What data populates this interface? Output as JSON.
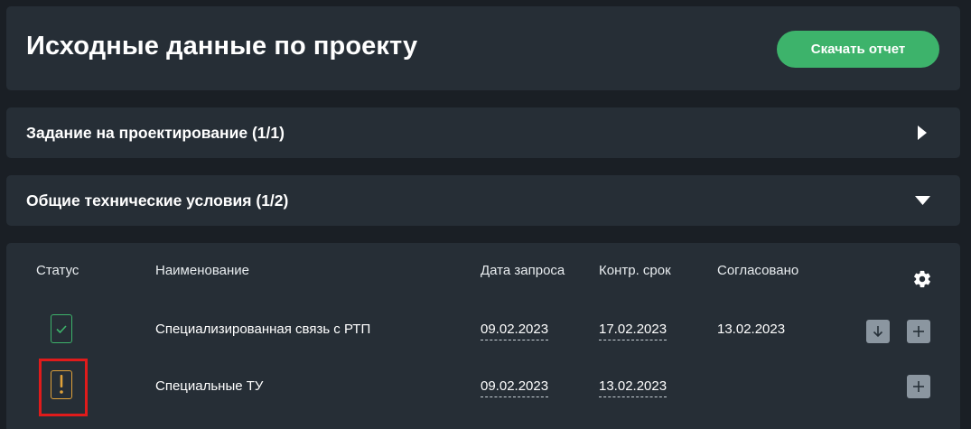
{
  "header": {
    "title": "Исходные данные по проекту",
    "download_label": "Скачать отчет"
  },
  "sections": [
    {
      "title": "Задание на проектирование (1/1)",
      "state": "collapsed"
    },
    {
      "title": "Общие технические условия (1/2)",
      "state": "expanded"
    }
  ],
  "table": {
    "columns": {
      "status": "Статус",
      "name": "Наименование",
      "request_date": "Дата запроса",
      "control_date": "Контр. срок",
      "approved": "Согласовано"
    },
    "rows": [
      {
        "status": "ok",
        "name": "Специализированная связь с РТП",
        "request_date": "09.02.2023",
        "control_date": "17.02.2023",
        "approved": "13.02.2023"
      },
      {
        "status": "warning",
        "name": "Специальные ТУ",
        "request_date": "09.02.2023",
        "control_date": "13.02.2023",
        "approved": ""
      }
    ]
  },
  "icons": {
    "settings": "gear-icon",
    "download": "arrow-down-icon",
    "add": "plus-icon",
    "expand": "triangle-right-icon",
    "collapse": "triangle-down-icon",
    "ok": "check-icon",
    "warning": "exclamation-icon"
  },
  "colors": {
    "background": "#1a1f25",
    "card": "#262e36",
    "accent_green": "#3db36b",
    "warning_orange": "#e0a23a",
    "highlight_red": "#e01b1b",
    "square_button": "#8b96a0"
  }
}
